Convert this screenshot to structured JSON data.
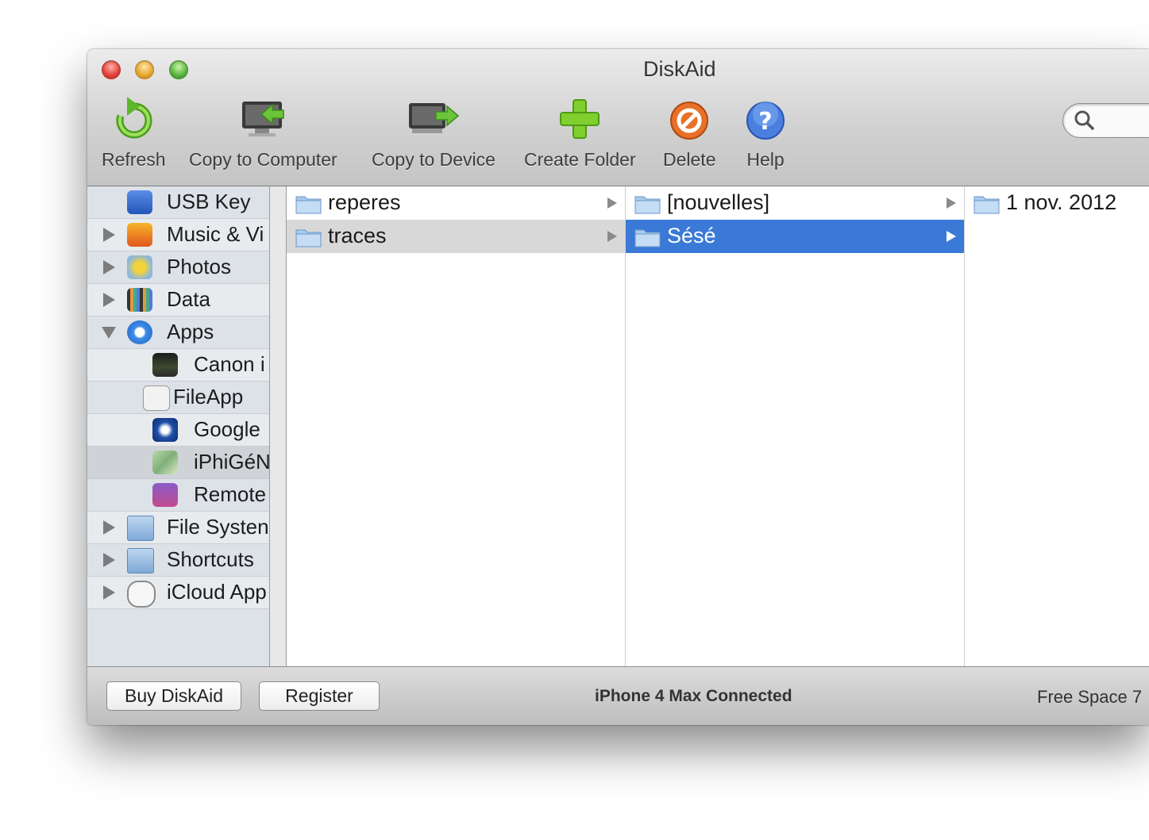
{
  "window": {
    "title": "DiskAid"
  },
  "toolbar": {
    "refresh": "Refresh",
    "copy_to_computer": "Copy to Computer",
    "copy_to_device": "Copy to Device",
    "create_folder": "Create Folder",
    "delete": "Delete",
    "help": "Help"
  },
  "search": {
    "icon": "magnifier-icon"
  },
  "sidebar": {
    "items": [
      {
        "label": "USB Key",
        "icon": "usb-key-icon",
        "disclosure": "none"
      },
      {
        "label": "Music & Vi",
        "icon": "music-icon",
        "disclosure": "collapsed"
      },
      {
        "label": "Photos",
        "icon": "photos-icon",
        "disclosure": "collapsed"
      },
      {
        "label": "Data",
        "icon": "data-icon",
        "disclosure": "collapsed"
      },
      {
        "label": "Apps",
        "icon": "app-store-icon",
        "disclosure": "expanded"
      },
      {
        "label": "Canon i",
        "icon": "canon-app-icon",
        "disclosure": "child"
      },
      {
        "label": "FileApp",
        "icon": "fileapp-icon",
        "disclosure": "child"
      },
      {
        "label": "Google",
        "icon": "google-app-icon",
        "disclosure": "child"
      },
      {
        "label": "iPhiGéN",
        "icon": "map-app-icon",
        "disclosure": "child"
      },
      {
        "label": "Remote",
        "icon": "remote-app-icon",
        "disclosure": "child"
      },
      {
        "label": "File Systen",
        "icon": "folder-icon",
        "disclosure": "collapsed"
      },
      {
        "label": "Shortcuts",
        "icon": "shortcut-folder-icon",
        "disclosure": "collapsed"
      },
      {
        "label": "iCloud App",
        "icon": "cloud-icon",
        "disclosure": "collapsed"
      }
    ]
  },
  "browser": {
    "column1": [
      {
        "label": "reperes"
      },
      {
        "label": "traces"
      }
    ],
    "column2": [
      {
        "label": "[nouvelles]"
      },
      {
        "label": "Sésé"
      }
    ],
    "column3": [
      {
        "label": "1 nov. 2012"
      }
    ]
  },
  "footer": {
    "buy_label": "Buy DiskAid",
    "register_label": "Register",
    "status": "iPhone 4 Max Connected",
    "free_space": "Free Space 7"
  },
  "colors": {
    "selection": "#3a79d6",
    "window_bg": "#e8e8e8"
  }
}
